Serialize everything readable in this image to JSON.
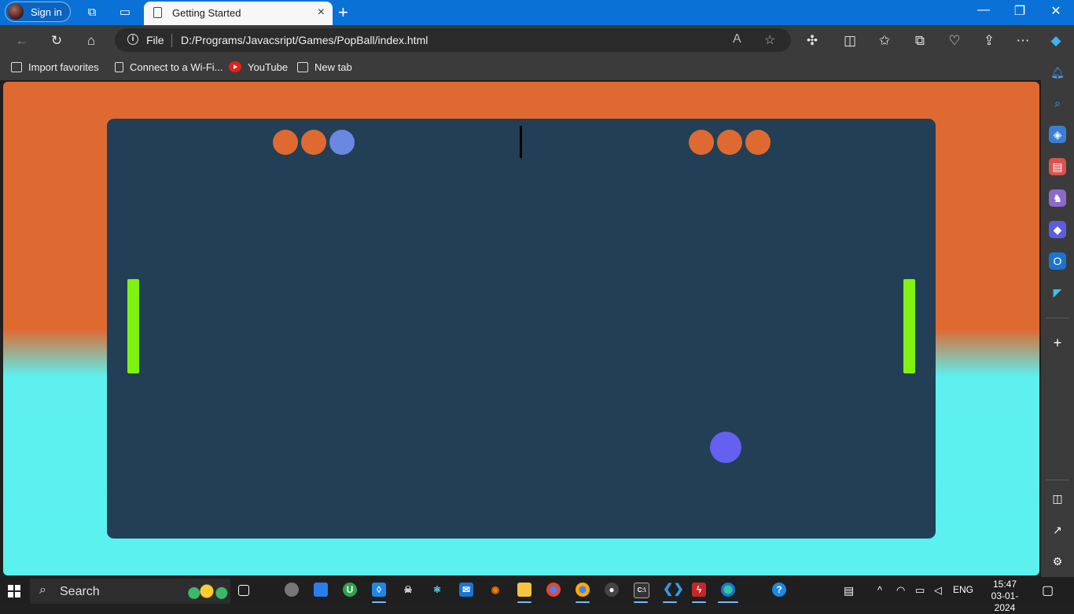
{
  "titlebar": {
    "signin_label": "Sign in",
    "tab_title": "Getting Started",
    "tab_close_icon": "×",
    "new_tab_icon": "+",
    "minimize_icon": "—",
    "maximize_icon": "❐",
    "close_icon": "✕"
  },
  "address": {
    "scheme": "File",
    "url": "D:/Programs/Javacsript/Games/PopBall/index.html"
  },
  "favorites": [
    {
      "label": "Import favorites",
      "icon": "import-icon"
    },
    {
      "label": "Connect to a Wi-Fi...",
      "icon": "page-icon"
    },
    {
      "label": "YouTube",
      "icon": "youtube-icon"
    },
    {
      "label": "New tab",
      "icon": "new-tab-icon"
    }
  ],
  "game": {
    "left_lives": [
      "alive",
      "alive",
      "lost"
    ],
    "right_lives": [
      "alive",
      "alive",
      "alive"
    ],
    "colors": {
      "page_top": "#de6a31",
      "page_bottom": "#5af1ef",
      "board": "#223f55",
      "paddle": "#7ff20f",
      "ball": "#6460f0",
      "life": "#de6a31",
      "life_lost": "#6a87e2"
    }
  },
  "taskbar": {
    "search_label": "Search",
    "language": "ENG",
    "time": "15:47",
    "date": "03-01-2024"
  }
}
